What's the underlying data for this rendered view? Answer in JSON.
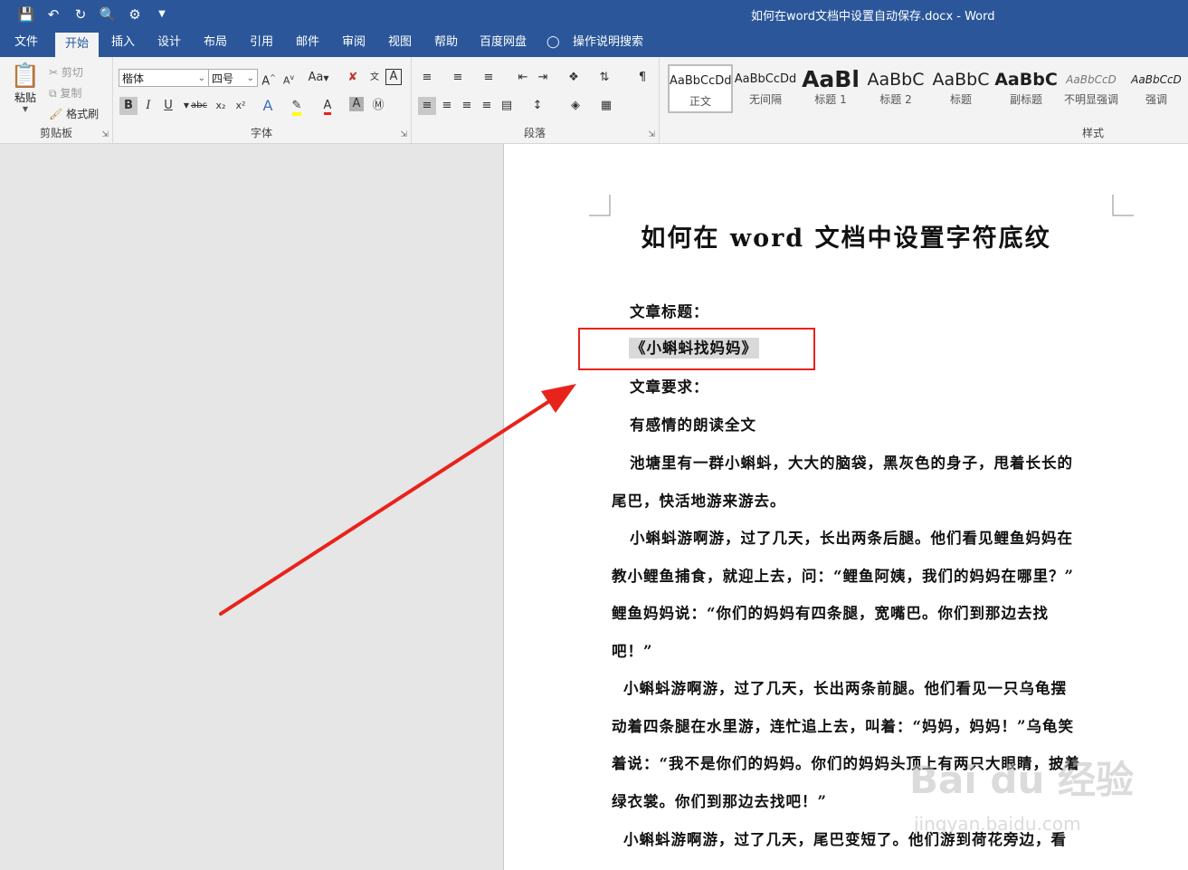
{
  "window": {
    "title": "如何在word文档中设置自动保存.docx  -  Word"
  },
  "quick_access": [
    "save-icon",
    "undo-icon",
    "redo-icon",
    "print-preview-icon",
    "touch-mode-icon",
    "customize-icon"
  ],
  "tabs": [
    "文件",
    "开始",
    "插入",
    "设计",
    "布局",
    "引用",
    "邮件",
    "审阅",
    "视图",
    "帮助",
    "百度网盘",
    "操作说明搜索"
  ],
  "ribbon": {
    "clipboard": {
      "paste": "粘贴",
      "cut": "剪切",
      "copy": "复制",
      "format_painter": "格式刷",
      "label": "剪贴板"
    },
    "font": {
      "font_name": "楷体",
      "font_size": "四号",
      "label": "字体",
      "change_case": "Aa",
      "grow": "A",
      "shrink": "A",
      "bold": "B",
      "italic": "I",
      "underline": "U",
      "strike": "abc",
      "sub": "x₂",
      "sup": "x²"
    },
    "paragraph": {
      "label": "段落"
    },
    "styles": {
      "label": "样式",
      "items": [
        {
          "sample": "AaBbCcDd",
          "name": "正文"
        },
        {
          "sample": "AaBbCcDd",
          "name": "无间隔"
        },
        {
          "sample": "AaBl",
          "name": "标题 1"
        },
        {
          "sample": "AaBbC",
          "name": "标题 2"
        },
        {
          "sample": "AaBbC",
          "name": "标题"
        },
        {
          "sample": "AaBbC",
          "name": "副标题"
        },
        {
          "sample": "AaBbCcD",
          "name": "不明显强调"
        },
        {
          "sample": "AaBbCcD",
          "name": "强调"
        }
      ]
    }
  },
  "document": {
    "heading": "如何在 word 文档中设置字符底纹",
    "lines": [
      "文章标题：",
      "《小蝌蚪找妈妈》",
      "文章要求：",
      "有感情的朗读全文",
      "池塘里有一群小蝌蚪，大大的脑袋，黑灰色的身子，甩着长长的",
      "尾巴，快活地游来游去。",
      "小蝌蚪游啊游，过了几天，长出两条后腿。他们看见鲤鱼妈妈在",
      "教小鲤鱼捕食，就迎上去，问：“鲤鱼阿姨，我们的妈妈在哪里？”",
      "鲤鱼妈妈说：“你们的妈妈有四条腿，宽嘴巴。你们到那边去找",
      "吧！”",
      "小蝌蚪游啊游，过了几天，长出两条前腿。他们看见一只乌龟摆",
      "动着四条腿在水里游，连忙追上去，叫着：“妈妈，妈妈！”乌龟笑",
      "着说：“我不是你们的妈妈。你们的妈妈头顶上有两只大眼睛，披着",
      "绿衣裳。你们到那边去找吧！”",
      "小蝌蚪游啊游，过了几天，尾巴变短了。他们游到荷花旁边，看"
    ]
  },
  "watermark": {
    "main": "Bai du 经验",
    "sub": "jingyan.baidu.com"
  },
  "colors": {
    "brand": "#2b579a",
    "highlight_box": "#e8231c",
    "arrow": "#e8231c",
    "shading": "#d9d9d9"
  }
}
